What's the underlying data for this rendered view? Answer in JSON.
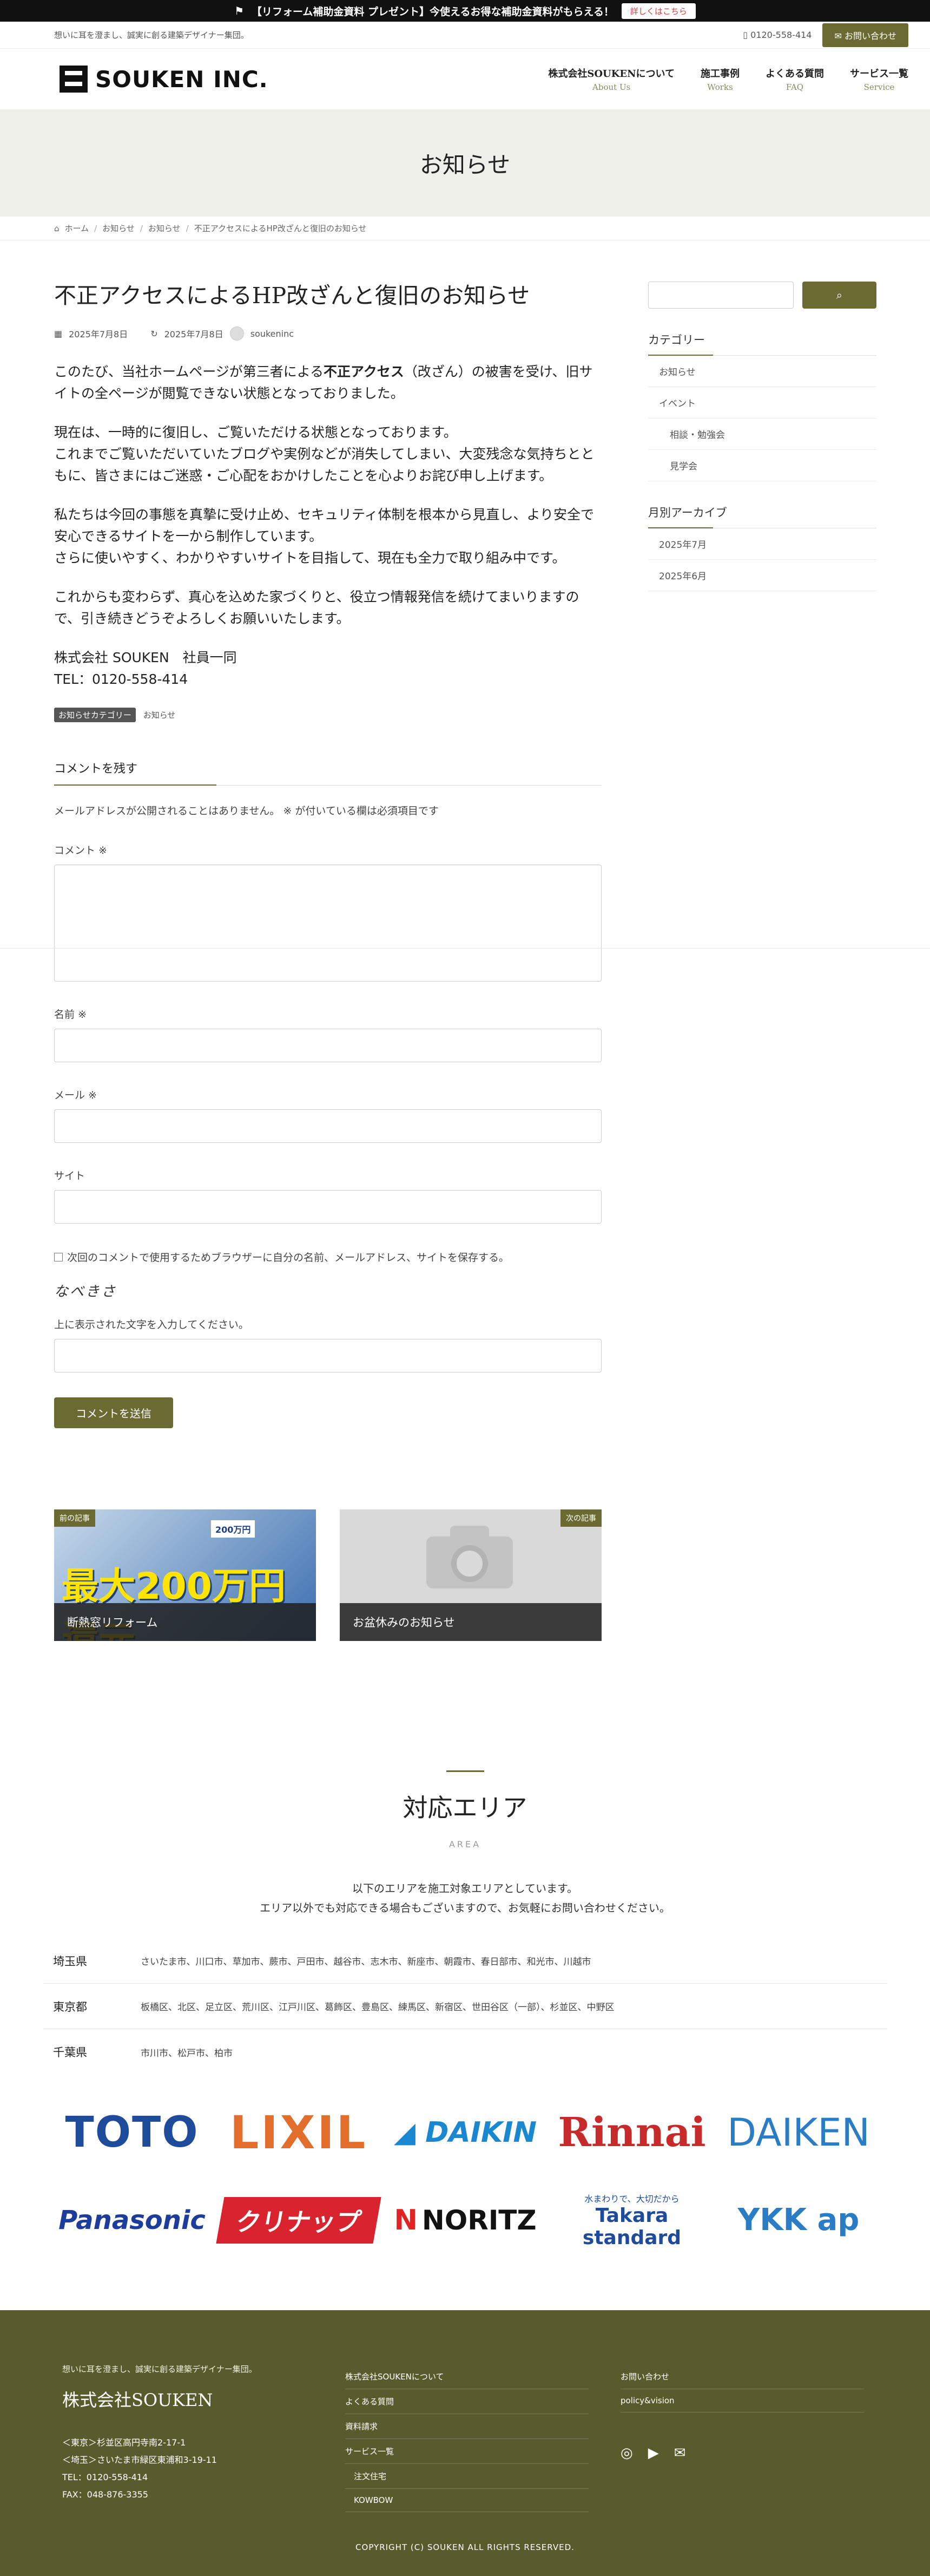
{
  "promo": {
    "text": "【リフォーム補助金資料 プレゼント】今使えるお得な補助金資料がもらえる！",
    "button": "詳しくはこちら"
  },
  "utility": {
    "tagline": "想いに耳を澄まし、誠実に創る建築デザイナー集団。",
    "phone": "0120-558-414",
    "contact_button": "お問い合わせ"
  },
  "header": {
    "logo_text": "SOUKEN INC.",
    "nav": [
      {
        "jp": "株式会社SOUKENについて",
        "en": "About Us"
      },
      {
        "jp": "施工事例",
        "en": "Works"
      },
      {
        "jp": "よくある質問",
        "en": "FAQ"
      },
      {
        "jp": "サービス一覧",
        "en": "Service"
      }
    ]
  },
  "page_title": "お知らせ",
  "breadcrumb": [
    "ホーム",
    "お知らせ",
    "お知らせ",
    "不正アクセスによるHP改ざんと復旧のお知らせ"
  ],
  "post": {
    "title": "不正アクセスによるHP改ざんと復旧のお知らせ",
    "published": "2025年7月8日",
    "updated": "2025年7月8日",
    "author": "soukeninc",
    "p1_before": "このたび、当社ホームページが第三者による",
    "p1_bold": "不正アクセス",
    "p1_after": "（改ざん）の被害を受け、旧サイトの全ページが閲覧できない状態となっておりました。",
    "p2_l1": "現在は、一時的に復旧し、ご覧いただける状態となっております。",
    "p2_l2": "これまでご覧いただいていたブログや実例などが消失してしまい、大変残念な気持ちとともに、皆さまにはご迷惑・ご心配をおかけしたことを心よりお詫び申し上げます。",
    "p3_l1": "私たちは今回の事態を真摯に受け止め、セキュリティ体制を根本から見直し、より安全で安心できるサイトを一から制作しています。",
    "p3_l2": "さらに使いやすく、わかりやすいサイトを目指して、現在も全力で取り組み中です。",
    "p4": "これからも変わらず、真心を込めた家づくりと、役立つ情報発信を続けてまいりますので、引き続きどうぞよろしくお願いいたします。",
    "sign1": "株式会社 SOUKEN　社員一同",
    "sign2": "TEL：0120-558-414",
    "tag_label": "お知らせカテゴリー",
    "tag_value": "お知らせ"
  },
  "comment": {
    "heading": "コメントを残す",
    "notice": "メールアドレスが公開されることはありません。 ※ が付いている欄は必須項目です",
    "comment_label": "コメント ※",
    "name_label": "名前 ※",
    "email_label": "メール ※",
    "site_label": "サイト",
    "save_label": "次回のコメントで使用するためブラウザーに自分の名前、メールアドレス、サイトを保存する。",
    "captcha_text": "なべきさ",
    "captcha_label": "上に表示された文字を入力してください。",
    "submit": "コメントを送信"
  },
  "postnav": {
    "prev_badge": "前の記事",
    "prev_title": "断熱窓リフォーム",
    "prev_visual_text": "最大200万円還元",
    "next_badge": "次の記事",
    "next_title": "お盆休みのお知らせ"
  },
  "sidebar": {
    "search_icon": "search-icon",
    "category_title": "カテゴリー",
    "categories": [
      "お知らせ",
      "イベント",
      "相談・勉強会",
      "見学会"
    ],
    "archive_title": "月別アーカイブ",
    "archives": [
      "2025年7月",
      "2025年6月"
    ]
  },
  "area": {
    "title": "対応エリア",
    "subtitle": "AREA",
    "desc1": "以下のエリアを施工対象エリアとしています。",
    "desc2": "エリア以外でも対応できる場合もございますので、お気軽にお問い合わせください。",
    "rows": [
      {
        "pref": "埼玉県",
        "cities": "さいたま市、川口市、草加市、蕨市、戸田市、越谷市、志木市、新座市、朝霞市、春日部市、和光市、川越市"
      },
      {
        "pref": "東京都",
        "cities": "板橋区、北区、足立区、荒川区、江戸川区、葛飾区、豊島区、練馬区、新宿区、世田谷区（一部）、杉並区、中野区"
      },
      {
        "pref": "千葉県",
        "cities": "市川市、松戸市、柏市"
      }
    ]
  },
  "brands": {
    "toto": "TOTO",
    "lixil": "LIXIL",
    "daikin": "DAIKIN",
    "rinnai": "Rinnai",
    "daiken": "DAIKEN",
    "panasonic": "Panasonic",
    "cleanup": "クリナップ",
    "noritz": "NORITZ",
    "takara_tag": "水まわりで、大切だから",
    "takara": "Takara standard",
    "ykk": "YKK ap"
  },
  "footer": {
    "tagline": "想いに耳を澄まし、誠実に創る建築デザイナー集団。",
    "company": "株式会社SOUKEN",
    "addr1": "＜東京＞杉並区高円寺南2-17-1",
    "addr2": "＜埼玉＞さいたま市緑区東浦和3-19-11",
    "tel": "TEL：0120-558-414",
    "fax": "FAX：048-876-3355",
    "links": [
      "株式会社SOUKENについて",
      "よくある質問",
      "資料請求",
      "サービス一覧",
      "注文住宅",
      "KOWBOW"
    ],
    "links2": [
      "お問い合わせ",
      "policy&vision"
    ],
    "copyright": "COPYRIGHT (C)  SOUKEN  ALL RIGHTS RESERVED."
  }
}
